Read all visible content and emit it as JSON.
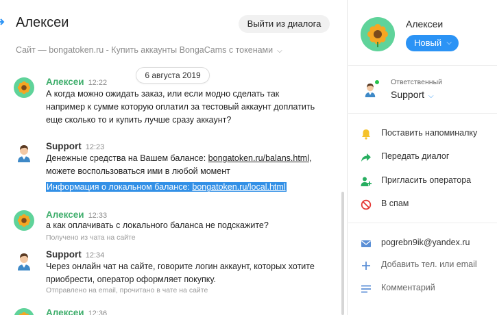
{
  "chat": {
    "contact_name": "Алексеи",
    "leave_label": "Выйти из диалога",
    "site_line": "Сайт — bongatoken.ru - Купить аккаунты BongaCams с токенами",
    "date_pill": "6 августа 2019",
    "messages": [
      {
        "name": "Алексеи",
        "time": "12:22",
        "lines": [
          "А когда можно ожидать заказ, или если модно сделать так",
          "например к сумме которую оплатил за тестовый аккаунт доплатить",
          "еще сколько то и купить лучше сразу аккаунт?"
        ]
      },
      {
        "name": "Support",
        "time": "12:23",
        "line1_prefix": "Денежные средства на Вашем балансе: ",
        "line1_link": "bongatoken.ru/balans.html",
        "line1_suffix": ",",
        "line2": "можете воспользоваться ими в любой момент",
        "line3_prefix": "Информация о локальном балансе: ",
        "line3_link": "bongatoken.ru/local.html"
      },
      {
        "name": "Алексеи",
        "time": "12:33",
        "lines": [
          "а как оплачивать с локального баланса не подскажите?"
        ],
        "note": "Получено из чата на сайте"
      },
      {
        "name": "Support",
        "time": "12:34",
        "lines": [
          "Через онлайн чат на сайте, говорите логин аккаунт, которых хотите",
          "приобрести, оператор оформляет покупку."
        ],
        "note": "Отправлено на email, прочитано в чате на сайте"
      },
      {
        "name": "Алексеи",
        "time": "12:36"
      }
    ]
  },
  "info": {
    "name": "Алексеи",
    "status_label": "Новый",
    "responsible_label": "Ответственный",
    "responsible_value": "Support",
    "actions": [
      {
        "label": "Поставить напоминалку",
        "icon": "bell-icon"
      },
      {
        "label": "Передать диалог",
        "icon": "forward-arrow-icon"
      },
      {
        "label": "Пригласить оператора",
        "icon": "add-user-icon"
      },
      {
        "label": "В спам",
        "icon": "block-icon"
      }
    ],
    "contacts": [
      {
        "label": "pogrebn9ik@yandex.ru",
        "icon": "mail-icon"
      },
      {
        "label": "Добавить тел. или email",
        "icon": "plus-icon"
      },
      {
        "label": "Комментарий",
        "icon": "comment-lines-icon"
      }
    ]
  },
  "colors": {
    "accent_blue": "#2b93f5",
    "name_green": "#3fae6c",
    "avatar_green": "#5fd39a",
    "highlight": "#3390e6",
    "bell": "#f5c22b",
    "forward": "#27ae60",
    "spam": "#e53935"
  }
}
